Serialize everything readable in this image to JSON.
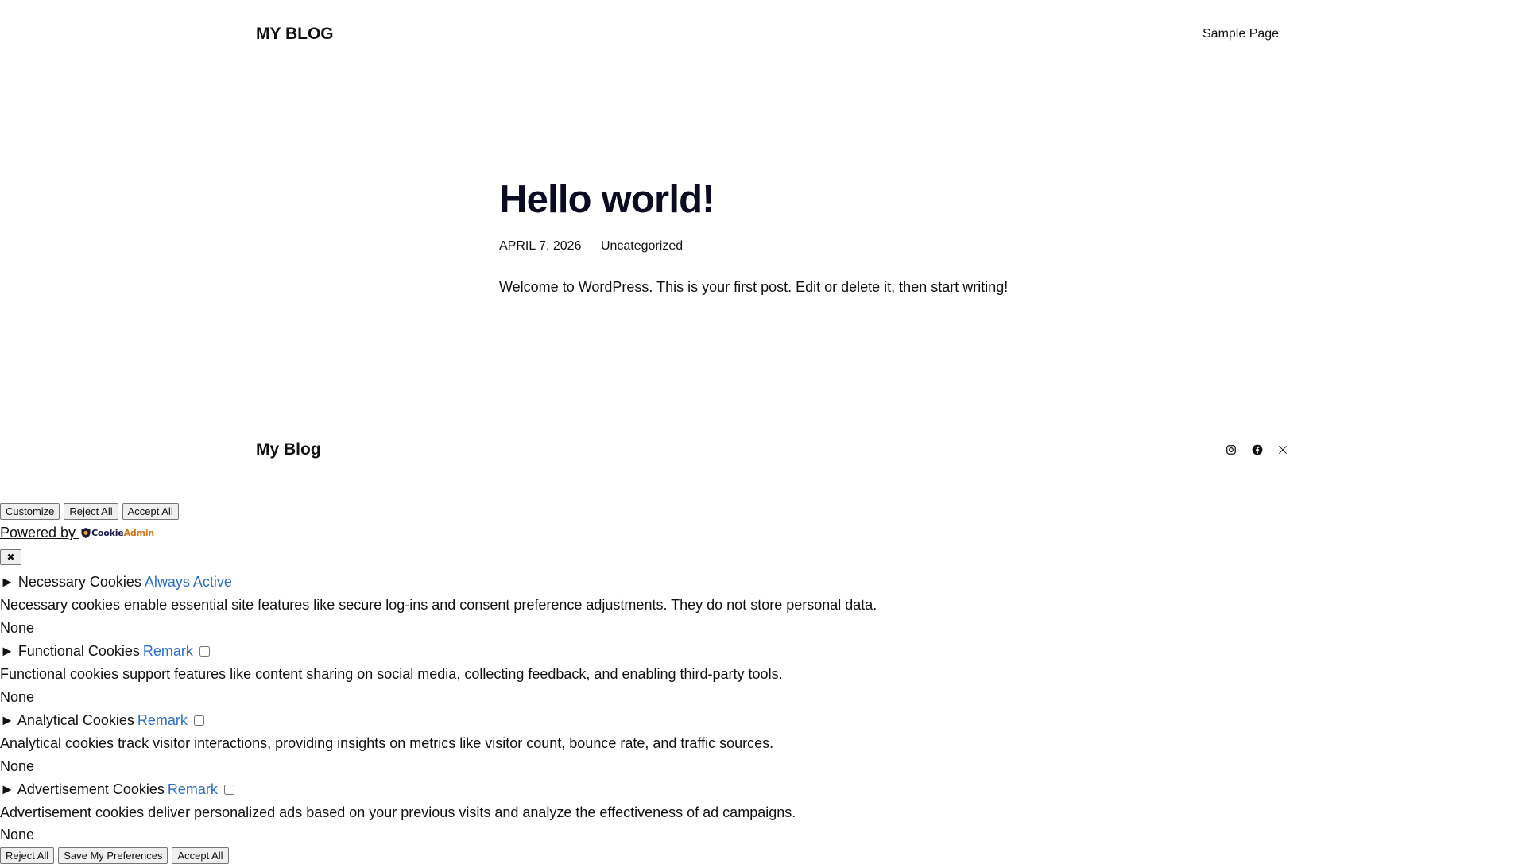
{
  "header": {
    "site_title": "MY BLOG",
    "nav": [
      "Sample Page"
    ]
  },
  "post": {
    "title": "Hello world!",
    "date": "APRIL 7, 2026",
    "category": "Uncategorized",
    "body": "Welcome to WordPress. This is your first post. Edit or delete it, then start writing!"
  },
  "footer": {
    "site_title": "My Blog",
    "social_icons": [
      "instagram-icon",
      "facebook-icon",
      "x-icon"
    ]
  },
  "cookie_banner": {
    "buttons": [
      "Customize",
      "Reject All",
      "Accept All"
    ],
    "powered_by": "Powered by ",
    "powered_logo": {
      "main": "Cookie",
      "accent": "Admin"
    },
    "close_label": "✖",
    "sections": [
      {
        "heading": "► Necessary Cookies",
        "link": "Always Active",
        "has_checkbox": false,
        "checked": false,
        "description": "Necessary cookies enable essential site features like secure log-ins and consent preference adjustments. They do not store personal data.",
        "cookies": "None"
      },
      {
        "heading": "► Functional Cookies",
        "link": "Remark",
        "has_checkbox": true,
        "checked": false,
        "description": "Functional cookies support features like content sharing on social media, collecting feedback, and enabling third-party tools.",
        "cookies": "None"
      },
      {
        "heading": "► Analytical Cookies",
        "link": "Remark",
        "has_checkbox": true,
        "checked": false,
        "description": "Analytical cookies track visitor interactions, providing insights on metrics like visitor count, bounce rate, and traffic sources.",
        "cookies": "None"
      },
      {
        "heading": "► Advertisement Cookies",
        "link": "Remark",
        "has_checkbox": true,
        "checked": false,
        "description": "Advertisement cookies deliver personalized ads based on your previous visits and analyze the effectiveness of ad campaigns.",
        "cookies": "None"
      }
    ],
    "footer_buttons": [
      "Reject All",
      "Save My Preferences",
      "Accept All"
    ]
  },
  "colors": {
    "link": "#2a6fc7",
    "title": "#0b0b22",
    "logo_accent": "#d1761a"
  }
}
